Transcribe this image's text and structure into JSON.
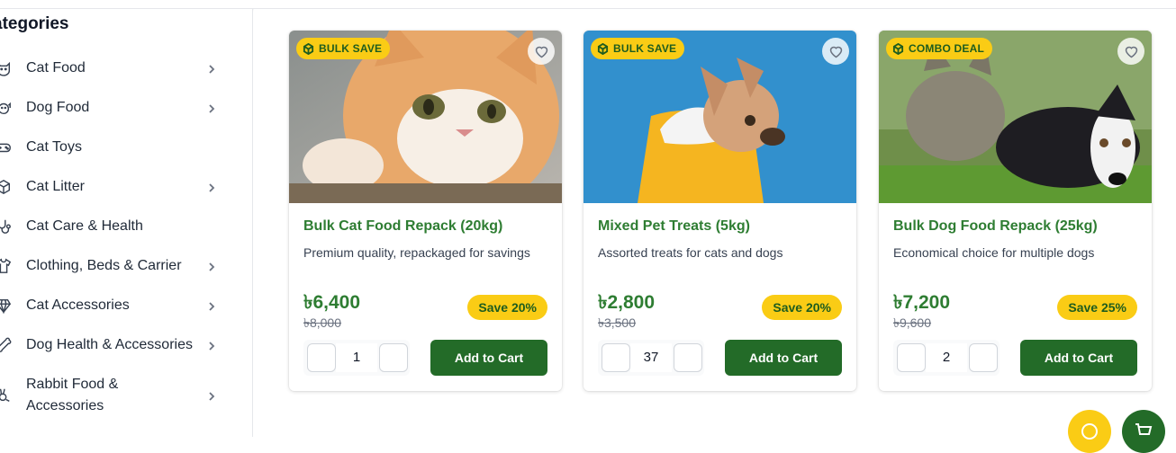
{
  "sidebar": {
    "title": "ategories",
    "items": [
      {
        "label": "Cat Food",
        "icon": "cat-face-icon",
        "chevron": true
      },
      {
        "label": "Dog Food",
        "icon": "dog-face-icon",
        "chevron": true
      },
      {
        "label": "Cat Toys",
        "icon": "gamepad-icon",
        "chevron": false
      },
      {
        "label": "Cat Litter",
        "icon": "box-icon",
        "chevron": true
      },
      {
        "label": "Cat Care & Health",
        "icon": "stethoscope-icon",
        "chevron": false
      },
      {
        "label": "Clothing, Beds & Carrier",
        "icon": "shirt-icon",
        "chevron": true
      },
      {
        "label": "Cat Accessories",
        "icon": "gem-icon",
        "chevron": true
      },
      {
        "label": "Dog Health & Accessories",
        "icon": "bone-icon",
        "chevron": true
      },
      {
        "label": "Rabbit Food &\nAccessories",
        "icon": "rabbit-icon",
        "chevron": true
      }
    ]
  },
  "products": [
    {
      "badge": "BULK SAVE",
      "image": "cat-photo",
      "title": "Bulk Cat Food Repack (20kg)",
      "description": "Premium quality, repackaged for savings",
      "price": "৳6,400",
      "old_price": "৳8,000",
      "save": "Save 20%",
      "quantity": "1",
      "cta": "Add to Cart"
    },
    {
      "badge": "BULK SAVE",
      "image": "dog-photo",
      "title": "Mixed Pet Treats (5kg)",
      "description": "Assorted treats for cats and dogs",
      "price": "৳2,800",
      "old_price": "৳3,500",
      "save": "Save 20%",
      "quantity": "37",
      "cta": "Add to Cart"
    },
    {
      "badge": "COMBO DEAL",
      "image": "cat-and-dog-photo",
      "title": "Bulk Dog Food Repack (25kg)",
      "description": "Economical choice for multiple dogs",
      "price": "৳7,200",
      "old_price": "৳9,600",
      "save": "Save 25%",
      "quantity": "2",
      "cta": "Add to Cart"
    }
  ],
  "colors": {
    "brand_green": "#236b28",
    "accent_yellow": "#facc15",
    "title_green": "#2e7d32"
  },
  "fabs": [
    {
      "icon": "chat-icon",
      "color": "#facc15"
    },
    {
      "icon": "cart-icon",
      "color": "#236b28"
    }
  ]
}
